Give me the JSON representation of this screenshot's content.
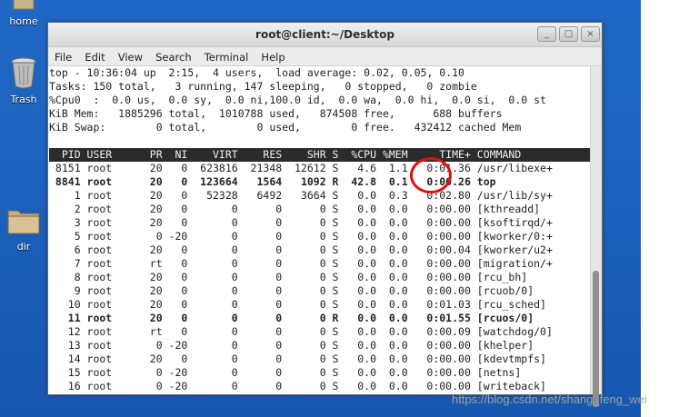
{
  "desktop": {
    "icons": [
      {
        "label": "home"
      },
      {
        "label": "Trash"
      },
      {
        "label": "dir"
      }
    ]
  },
  "window": {
    "title": "root@client:~/Desktop",
    "menu": [
      "File",
      "Edit",
      "View",
      "Search",
      "Terminal",
      "Help"
    ],
    "buttons": {
      "minimize": "_",
      "maximize": "□",
      "close": "×"
    }
  },
  "summary": [
    "top - 10:36:04 up  2:15,  4 users,  load average: 0.02, 0.05, 0.10",
    "Tasks: 150 total,   3 running, 147 sleeping,   0 stopped,   0 zombie",
    "%Cpu0  :  0.0 us,  0.0 sy,  0.0 ni,100.0 id,  0.0 wa,  0.0 hi,  0.0 si,  0.0 st",
    "KiB Mem:   1885296 total,  1010788 used,   874508 free,      688 buffers",
    "KiB Swap:        0 total,        0 used,        0 free.   432412 cached Mem"
  ],
  "table": {
    "header": "  PID USER      PR  NI    VIRT    RES    SHR S  %CPU %MEM     TIME+ COMMAND",
    "rows": [
      {
        "text": " 8151 root      20   0  623816  21348  12612 S   4.6  1.1   0:01.36 /usr/libexe+",
        "bold": false
      },
      {
        "text": " 8841 root      20   0  123664   1564   1092 R  42.8  0.1   0:00.26 top",
        "bold": true
      },
      {
        "text": "    1 root      20   0   52328   6492   3664 S   0.0  0.3   0:02.80 /usr/lib/sy+",
        "bold": false
      },
      {
        "text": "    2 root      20   0       0      0      0 S   0.0  0.0   0:00.00 [kthreadd]",
        "bold": false
      },
      {
        "text": "    3 root      20   0       0      0      0 S   0.0  0.0   0:00.00 [ksoftirqd/+",
        "bold": false
      },
      {
        "text": "    5 root       0 -20       0      0      0 S   0.0  0.0   0:00.00 [kworker/0:+",
        "bold": false
      },
      {
        "text": "    6 root      20   0       0      0      0 S   0.0  0.0   0:00.04 [kworker/u2+",
        "bold": false
      },
      {
        "text": "    7 root      rt   0       0      0      0 S   0.0  0.0   0:00.00 [migration/+",
        "bold": false
      },
      {
        "text": "    8 root      20   0       0      0      0 S   0.0  0.0   0:00.00 [rcu_bh]",
        "bold": false
      },
      {
        "text": "    9 root      20   0       0      0      0 S   0.0  0.0   0:00.00 [rcuob/0]",
        "bold": false
      },
      {
        "text": "   10 root      20   0       0      0      0 S   0.0  0.0   0:01.03 [rcu_sched]",
        "bold": false
      },
      {
        "text": "   11 root      20   0       0      0      0 R   0.0  0.0   0:01.55 [rcuos/0]",
        "bold": true
      },
      {
        "text": "   12 root      rt   0       0      0      0 S   0.0  0.0   0:00.09 [watchdog/0]",
        "bold": false
      },
      {
        "text": "   13 root       0 -20       0      0      0 S   0.0  0.0   0:00.00 [khelper]",
        "bold": false
      },
      {
        "text": "   14 root      20   0       0      0      0 S   0.0  0.0   0:00.00 [kdevtmpfs]",
        "bold": false
      },
      {
        "text": "   15 root       0 -20       0      0      0 S   0.0  0.0   0:00.00 [netns]",
        "bold": false
      },
      {
        "text": "   16 root       0 -20       0      0      0 S   0.0  0.0   0:00.00 [writeback]",
        "bold": false
      }
    ]
  },
  "annotation": {
    "color": "#e01010",
    "target": "%CPU"
  },
  "watermark": "https://blog.csdn.net/shang_feng_wei"
}
